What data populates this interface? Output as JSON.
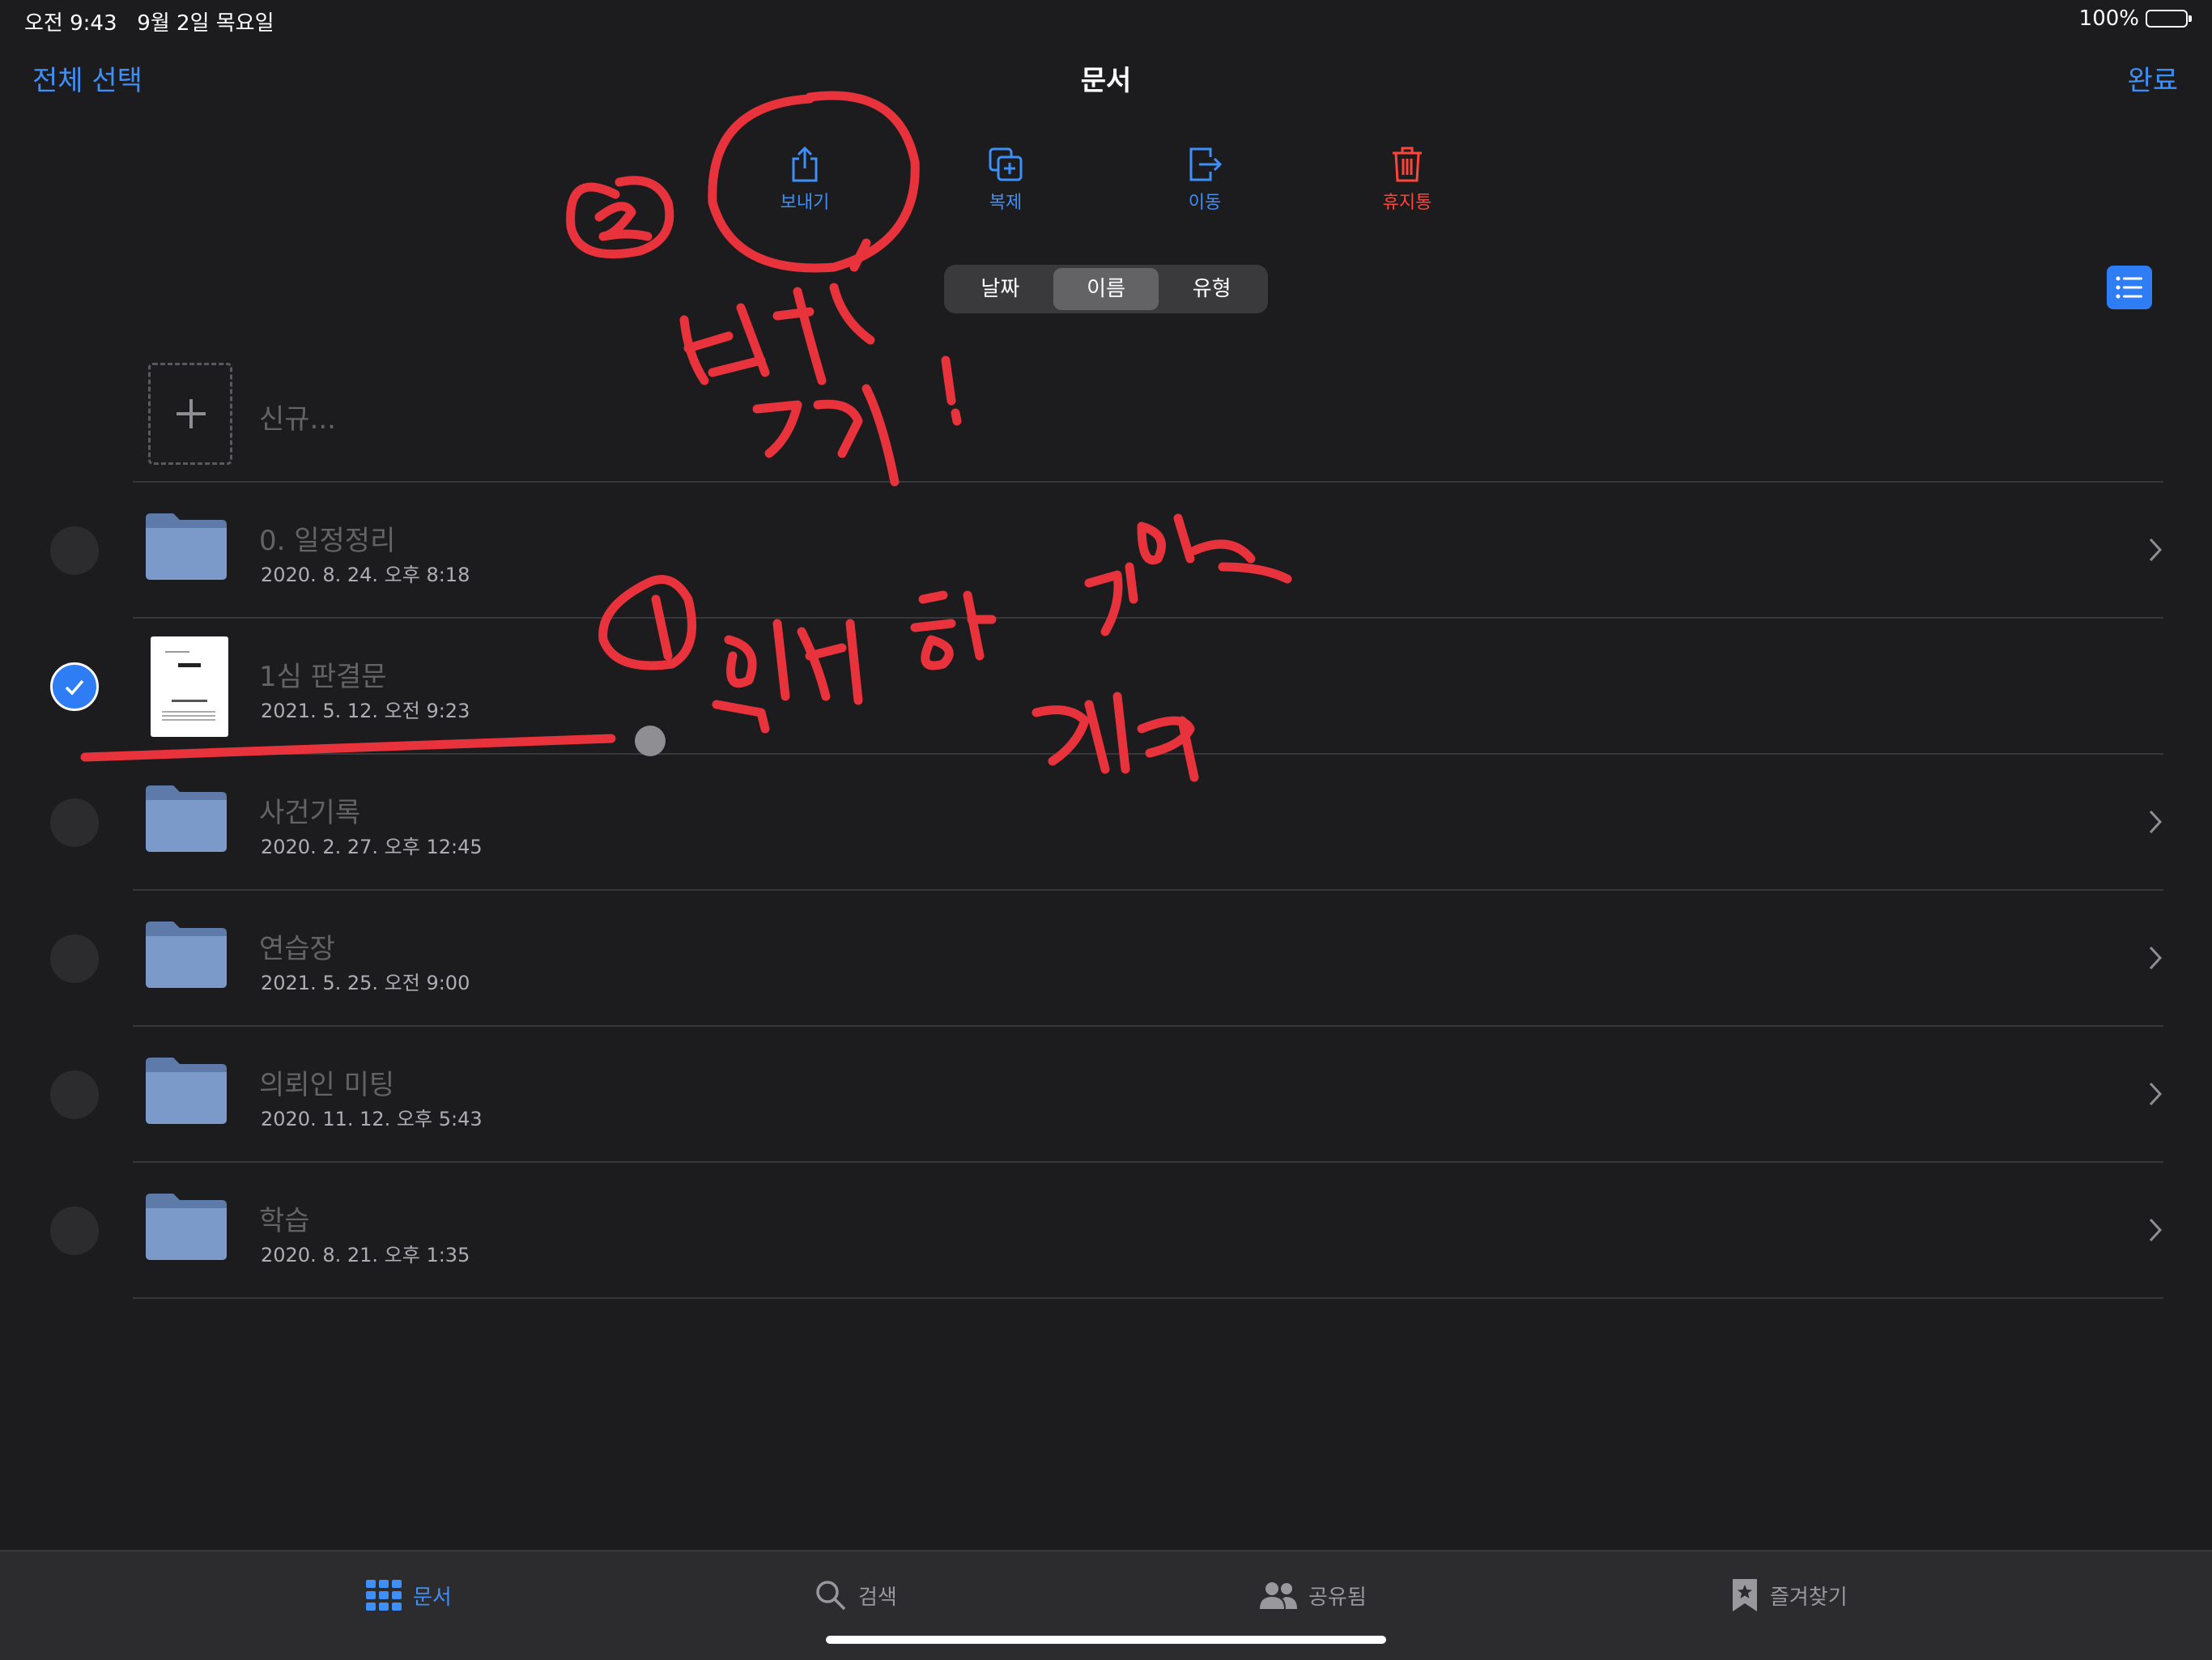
{
  "status_bar": {
    "time": "오전 9:43",
    "date": "9월 2일 목요일",
    "battery": "100%"
  },
  "nav": {
    "select_all": "전체 선택",
    "title": "문서",
    "done": "완료"
  },
  "actions": [
    {
      "label": "보내기",
      "icon": "share-icon"
    },
    {
      "label": "복제",
      "icon": "duplicate-icon"
    },
    {
      "label": "이동",
      "icon": "move-icon"
    },
    {
      "label": "휴지통",
      "icon": "trash-icon"
    }
  ],
  "sort": {
    "options": [
      "날짜",
      "이름",
      "유형"
    ],
    "selected": "이름"
  },
  "new_item": {
    "label": "신규..."
  },
  "rows": [
    {
      "name": "0. 일정정리",
      "date": "2020. 8. 24. 오후 8:18",
      "type": "folder",
      "selected": false
    },
    {
      "name": "1심 판결문",
      "date": "2021. 5. 12. 오전 9:23",
      "type": "document",
      "selected": true
    },
    {
      "name": "사건기록",
      "date": "2020. 2. 27. 오후 12:45",
      "type": "folder",
      "selected": false
    },
    {
      "name": "연습장",
      "date": "2021. 5. 25. 오전 9:00",
      "type": "folder",
      "selected": false
    },
    {
      "name": "의뢰인 미팅",
      "date": "2020. 11. 12. 오후 5:43",
      "type": "folder",
      "selected": false
    },
    {
      "name": "학습",
      "date": "2020. 8. 21. 오후 1:35",
      "type": "folder",
      "selected": false
    }
  ],
  "tabs": [
    {
      "label": "문서",
      "icon": "grid-icon",
      "active": true
    },
    {
      "label": "검색",
      "icon": "search-icon",
      "active": false
    },
    {
      "label": "공유됨",
      "icon": "people-icon",
      "active": false
    },
    {
      "label": "즐겨찾기",
      "icon": "bookmark-star-icon",
      "active": false
    }
  ],
  "colors": {
    "accent": "#3e8ff7",
    "destructive": "#ff453a",
    "annotation": "#e8323c",
    "background": "#1c1c1e"
  }
}
